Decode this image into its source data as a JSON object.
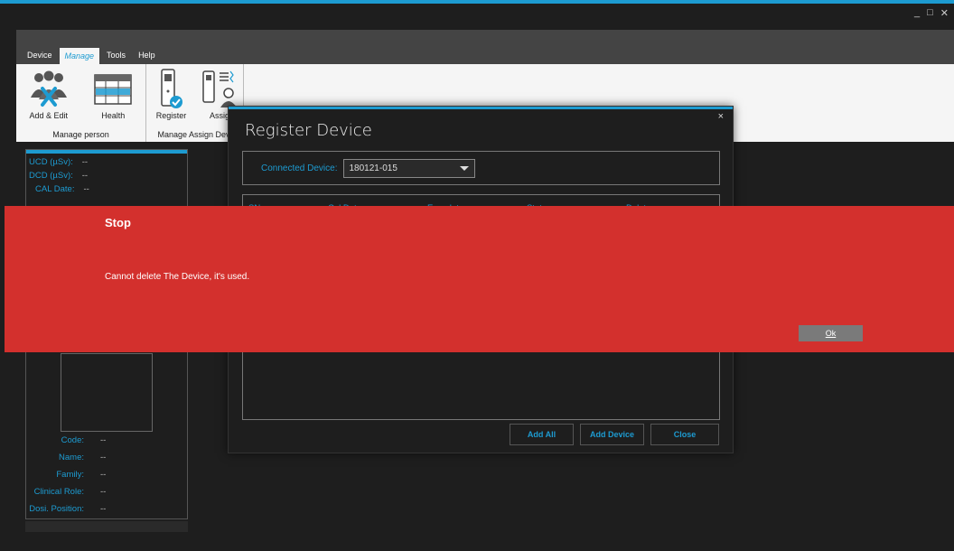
{
  "window": {
    "controls": [
      "_",
      "□",
      "✕"
    ]
  },
  "ribbon": {
    "tabs": [
      {
        "label": "Device"
      },
      {
        "label": "Manage"
      },
      {
        "label": "Tools"
      },
      {
        "label": "Help"
      }
    ],
    "groups": [
      {
        "label": "Manage person",
        "buttons": [
          {
            "label": "Add & Edit",
            "icon": "people-wrench-icon"
          },
          {
            "label": "Health",
            "icon": "table-grid-icon"
          }
        ]
      },
      {
        "label": "Manage Assign Devi",
        "buttons": [
          {
            "label": "Register",
            "icon": "device-check-icon"
          },
          {
            "label": "Assig",
            "icon": "device-person-icon"
          }
        ]
      }
    ]
  },
  "leftpanel": {
    "top_fields": [
      {
        "key": "UCD (µSv):",
        "value": "--"
      },
      {
        "key": "DCD (µSv):",
        "value": "--"
      },
      {
        "key": "CAL Date:",
        "value": "--"
      }
    ],
    "bottom_fields": [
      {
        "key": "Code:",
        "value": "--"
      },
      {
        "key": "Name:",
        "value": "--"
      },
      {
        "key": "Family:",
        "value": "--"
      },
      {
        "key": "Clinical Role:",
        "value": "--"
      },
      {
        "key": "Dosi. Position:",
        "value": "--"
      }
    ]
  },
  "modal": {
    "title": "Register Device",
    "close": "×",
    "connected_label": "Connected Device:",
    "connected_value": "180121-015",
    "columns": [
      "SN",
      "Cal Date",
      "Exp. date",
      "Status",
      "Delete"
    ],
    "buttons": {
      "add_all": "Add All",
      "add_device": "Add Device",
      "close": "Close"
    }
  },
  "alert": {
    "title": "Stop",
    "message": "Cannot delete The Device, it's used.",
    "ok_label": "Ok",
    "color": "#d3302d"
  },
  "colors": {
    "accent": "#1d9bd1",
    "background": "#1e1e1e"
  }
}
